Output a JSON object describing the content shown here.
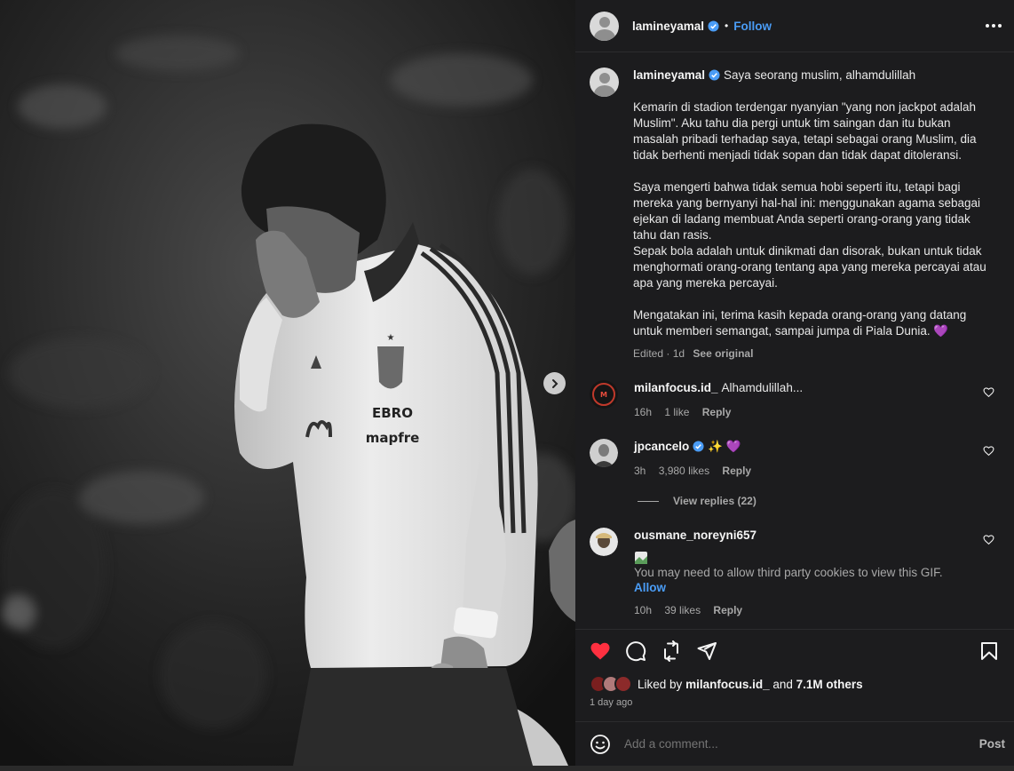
{
  "post": {
    "username": "lamineyamal",
    "follow_label": "Follow",
    "separator": "•"
  },
  "caption": {
    "username": "lamineyamal",
    "first_line": "Saya seorang muslim, alhamdulillah",
    "paragraph_1": "Kemarin di stadion terdengar nyanyian \"yang non jackpot adalah Muslim\". Aku tahu dia pergi untuk tim saingan dan itu bukan masalah pribadi terhadap saya, tetapi sebagai orang Muslim, dia tidak berhenti menjadi tidak sopan dan tidak dapat ditoleransi.",
    "paragraph_2": "Saya mengerti bahwa tidak semua hobi seperti itu, tetapi bagi mereka yang bernyanyi hal-hal ini: menggunakan agama sebagai ejekan di ladang membuat Anda seperti orang-orang yang tidak tahu dan rasis.",
    "paragraph_3": "Sepak bola adalah untuk dinikmati dan disorak, bukan untuk tidak menghormati orang-orang tentang apa yang mereka percayai atau apa yang mereka percayai.",
    "paragraph_4": "Mengatakan ini, terima kasih kepada orang-orang yang datang untuk memberi semangat, sampai jumpa di Piala Dunia. 💜",
    "edited": "Edited · 1d",
    "see_original": "See original"
  },
  "comments": [
    {
      "username": "milanfocus.id_",
      "text": "Alhamdulillah...",
      "age": "16h",
      "likes": "1 like",
      "reply": "Reply"
    },
    {
      "username": "jpcancelo",
      "text": "✨ 💜",
      "age": "3h",
      "likes": "3,980 likes",
      "reply": "Reply",
      "view_replies": "View replies (22)"
    },
    {
      "username": "ousmane_noreyni657",
      "gif_note": "You may need to allow third party cookies to view this GIF.",
      "allow": "Allow",
      "age": "10h",
      "likes": "39 likes",
      "reply": "Reply"
    }
  ],
  "likes": {
    "prefix": "Liked by",
    "liker": "milanfocus.id_",
    "and_text": "and",
    "others": "7.1M others",
    "time_ago": "1 day ago"
  },
  "add_comment": {
    "placeholder": "Add a comment...",
    "post_label": "Post"
  },
  "photo": {
    "jersey_text_1": "EBRO",
    "jersey_text_2": "mapfre"
  },
  "colors": {
    "accent": "#4a9cf5",
    "heart": "#ff3040",
    "panel": "#1c1c1e"
  },
  "icons": [
    "verified-badge-icon",
    "more-options-icon",
    "heart-icon",
    "comment-icon",
    "repost-icon",
    "share-icon",
    "bookmark-icon",
    "emoji-icon",
    "chevron-right-icon"
  ]
}
